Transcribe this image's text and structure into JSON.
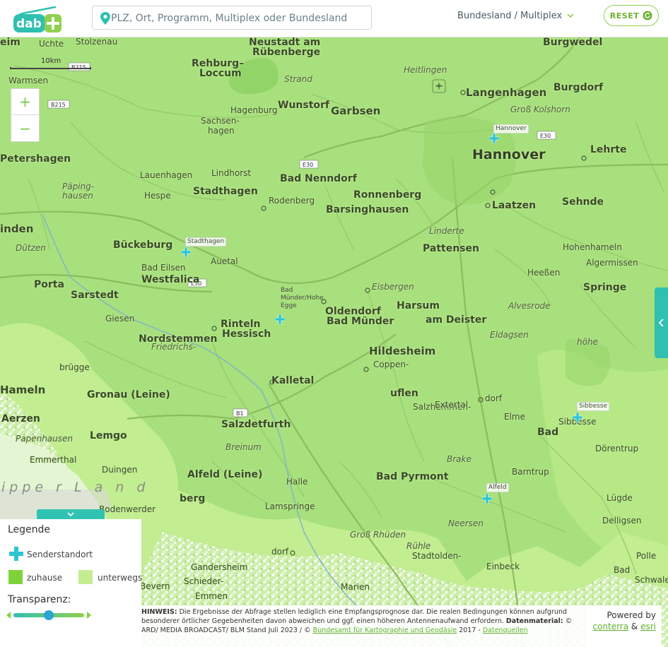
{
  "header": {
    "logo_text": "dab+",
    "search_placeholder": "PLZ, Ort, Programm, Multiplex oder Bundesland",
    "dropdown_label": "Bundesland / Multiplex",
    "reset_label": "RESET"
  },
  "map": {
    "scale_label": "10km",
    "zoom_in": "+",
    "zoom_out": "−",
    "region_label": "ippe r  L a n d",
    "road_labels": [
      "B215",
      "B215",
      "E30",
      "E30",
      "E30",
      "B1"
    ],
    "places": [
      {
        "name": "Neustadt am",
        "cls": "med"
      },
      {
        "name": "Rübenberge",
        "cls": "med"
      },
      {
        "name": "Rehburg–",
        "cls": "med"
      },
      {
        "name": "Loccum",
        "cls": "med"
      },
      {
        "name": "Burgwedel",
        "cls": "med"
      },
      {
        "name": "Uchte",
        "cls": "sm"
      },
      {
        "name": "Stolzenau",
        "cls": "sm"
      },
      {
        "name": "Warmsen",
        "cls": "sm"
      },
      {
        "name": "Heitlingen",
        "cls": "it"
      },
      {
        "name": "Strand",
        "cls": "it"
      },
      {
        "name": "Langenhagen",
        "cls": "big"
      },
      {
        "name": "Burgdorf",
        "cls": "med"
      },
      {
        "name": "Wunstorf",
        "cls": "med"
      },
      {
        "name": "Garbsen",
        "cls": "big"
      },
      {
        "name": "Hagenburg",
        "cls": "sm"
      },
      {
        "name": "Groß Kolshorn",
        "cls": "it"
      },
      {
        "name": "Sachsen-",
        "cls": "sm"
      },
      {
        "name": "hagen",
        "cls": "sm"
      },
      {
        "name": "Hannover",
        "cls": "xl"
      },
      {
        "name": "Lehrte",
        "cls": "med"
      },
      {
        "name": "Petershagen",
        "cls": "med"
      },
      {
        "name": "Lauenhagen",
        "cls": "sm"
      },
      {
        "name": "Lindhorst",
        "cls": "sm"
      },
      {
        "name": "Bad Nenndorf",
        "cls": "med"
      },
      {
        "name": "Päping-",
        "cls": "it"
      },
      {
        "name": "hausen",
        "cls": "it"
      },
      {
        "name": "Hespe",
        "cls": "sm"
      },
      {
        "name": "Stadthagen",
        "cls": "med"
      },
      {
        "name": "Ronnenberg",
        "cls": "med"
      },
      {
        "name": "Rodenberg",
        "cls": "sm"
      },
      {
        "name": "Barsinghausen",
        "cls": "med"
      },
      {
        "name": "Laatzen",
        "cls": "med"
      },
      {
        "name": "Sehnde",
        "cls": "med"
      },
      {
        "name": "inden",
        "cls": "big"
      },
      {
        "name": "Linderte",
        "cls": "it"
      },
      {
        "name": "Dützen",
        "cls": "it"
      },
      {
        "name": "Bückeburg",
        "cls": "med"
      },
      {
        "name": "Pattensen",
        "cls": "med"
      },
      {
        "name": "Hohenhameln",
        "cls": "sm"
      },
      {
        "name": "Auetal",
        "cls": "sm"
      },
      {
        "name": "Bad Eilsen",
        "cls": "sm"
      },
      {
        "name": "Algermissen",
        "cls": "sm"
      },
      {
        "name": "Porta",
        "cls": "med"
      },
      {
        "name": "Westfalica",
        "cls": "med"
      },
      {
        "name": "Heeßen",
        "cls": "sm"
      },
      {
        "name": "Sarstedt",
        "cls": "med"
      },
      {
        "name": "Eisbergen",
        "cls": "it"
      },
      {
        "name": "Springe",
        "cls": "med"
      },
      {
        "name": "Harsum",
        "cls": "med"
      },
      {
        "name": "Alvesrode",
        "cls": "it"
      },
      {
        "name": "Giesen",
        "cls": "sm"
      },
      {
        "name": "Rinteln",
        "cls": "med"
      },
      {
        "name": "Hessisch",
        "cls": "med"
      },
      {
        "name": "Oldendorf",
        "cls": "med"
      },
      {
        "name": "Bad Münder",
        "cls": "med"
      },
      {
        "name": "am Deister",
        "cls": "med"
      },
      {
        "name": "Eldagsen",
        "cls": "it"
      },
      {
        "name": "Nordstemmen",
        "cls": "med"
      },
      {
        "name": "Friedrichs-",
        "cls": "it"
      },
      {
        "name": "höhe",
        "cls": "it"
      },
      {
        "name": "Hildesheim",
        "cls": "big"
      },
      {
        "name": "Coppen-",
        "cls": "sm"
      },
      {
        "name": "brügge",
        "cls": "sm"
      },
      {
        "name": "Kalletal",
        "cls": "med"
      },
      {
        "name": "Hameln",
        "cls": "big"
      },
      {
        "name": "uflen",
        "cls": "med"
      },
      {
        "name": "Salzhemmen-",
        "cls": "sm"
      },
      {
        "name": "dorf",
        "cls": "sm"
      },
      {
        "name": "Gronau (Leine)",
        "cls": "med"
      },
      {
        "name": "Extertal",
        "cls": "sm"
      },
      {
        "name": "Elme",
        "cls": "sm"
      },
      {
        "name": "Sibbesse",
        "cls": "sm"
      },
      {
        "name": "Bad",
        "cls": "med"
      },
      {
        "name": "Salzdetfurth",
        "cls": "med"
      },
      {
        "name": "Aerzen",
        "cls": "med"
      },
      {
        "name": "Papenhausen",
        "cls": "it"
      },
      {
        "name": "Lemgo",
        "cls": "med"
      },
      {
        "name": "Dörentrup",
        "cls": "sm"
      },
      {
        "name": "Breinum",
        "cls": "it"
      },
      {
        "name": "Emmerthal",
        "cls": "sm"
      },
      {
        "name": "Brake",
        "cls": "it"
      },
      {
        "name": "Duingen",
        "cls": "sm"
      },
      {
        "name": "Barntrup",
        "cls": "sm"
      },
      {
        "name": "Alfeld (Leine)",
        "cls": "med"
      },
      {
        "name": "Bad Pyrmont",
        "cls": "med"
      },
      {
        "name": "Halle",
        "cls": "sm"
      },
      {
        "name": "Bodenwerder",
        "cls": "sm"
      },
      {
        "name": "berg",
        "cls": "med"
      },
      {
        "name": "Lügde",
        "cls": "sm"
      },
      {
        "name": "Lamspringe",
        "cls": "sm"
      },
      {
        "name": "Neersen",
        "cls": "it"
      },
      {
        "name": "Delligsen",
        "cls": "sm"
      },
      {
        "name": "Groß Rhüden",
        "cls": "it"
      },
      {
        "name": "Rühle",
        "cls": "it"
      },
      {
        "name": "Stadtolden-",
        "cls": "sm"
      },
      {
        "name": "dorf",
        "cls": "sm"
      },
      {
        "name": "Polle",
        "cls": "sm"
      },
      {
        "name": "Bad",
        "cls": "sm"
      },
      {
        "name": "Gandersheim",
        "cls": "sm"
      },
      {
        "name": "Schieder-",
        "cls": "sm"
      },
      {
        "name": "Schwalenberg",
        "cls": "sm"
      },
      {
        "name": "Einbeck",
        "cls": "sm"
      },
      {
        "name": "Emmen",
        "cls": "sm"
      },
      {
        "name": "Marien",
        "cls": "sm"
      },
      {
        "name": "Bevern",
        "cls": "sm"
      },
      {
        "name": "eim",
        "cls": "med"
      }
    ],
    "transmitters": [
      {
        "name": "Hannover"
      },
      {
        "name": "Stadthagen"
      },
      {
        "name": "Bad Münder/Hohe Egge"
      },
      {
        "name": "Sibbesse"
      },
      {
        "name": "Alfeld"
      }
    ]
  },
  "legend": {
    "title": "Legende",
    "transmitter_label": "Senderstandort",
    "home_label": "zuhause",
    "mobile_label": "unterwegs",
    "transparency_title": "Transparenz:",
    "transparency_value": 0.5,
    "colors": {
      "home": "#7ed33a",
      "mobile": "#c2ed90",
      "transmitter": "#2cc6d2",
      "accent": "#2fc0b0"
    }
  },
  "footer": {
    "hint_bold": "HINWEIS:",
    "hint_text": " Die Ergebnisse der Abfrage stellen lediglich eine Empfangsprognose dar. Die realen Bedingungen können aufgrund besonderer örtlicher Gegebenheiten davon abweichen und ggf. einen höheren Antennenaufwand erfordern. ",
    "data_bold": "Datenmaterial:",
    "data_text": " © ARD/ MEDIA BROADCAST/ BLM Stand Juli 2023 / © ",
    "link_bkg": "Bundesamt für Kartographie und Geodäsie",
    "year_text": " 2017 - ",
    "link_sources": "Datenquellen",
    "powered_by": "Powered by",
    "link_conterra": "conterra",
    "amp": " & ",
    "link_esri": "esri"
  }
}
